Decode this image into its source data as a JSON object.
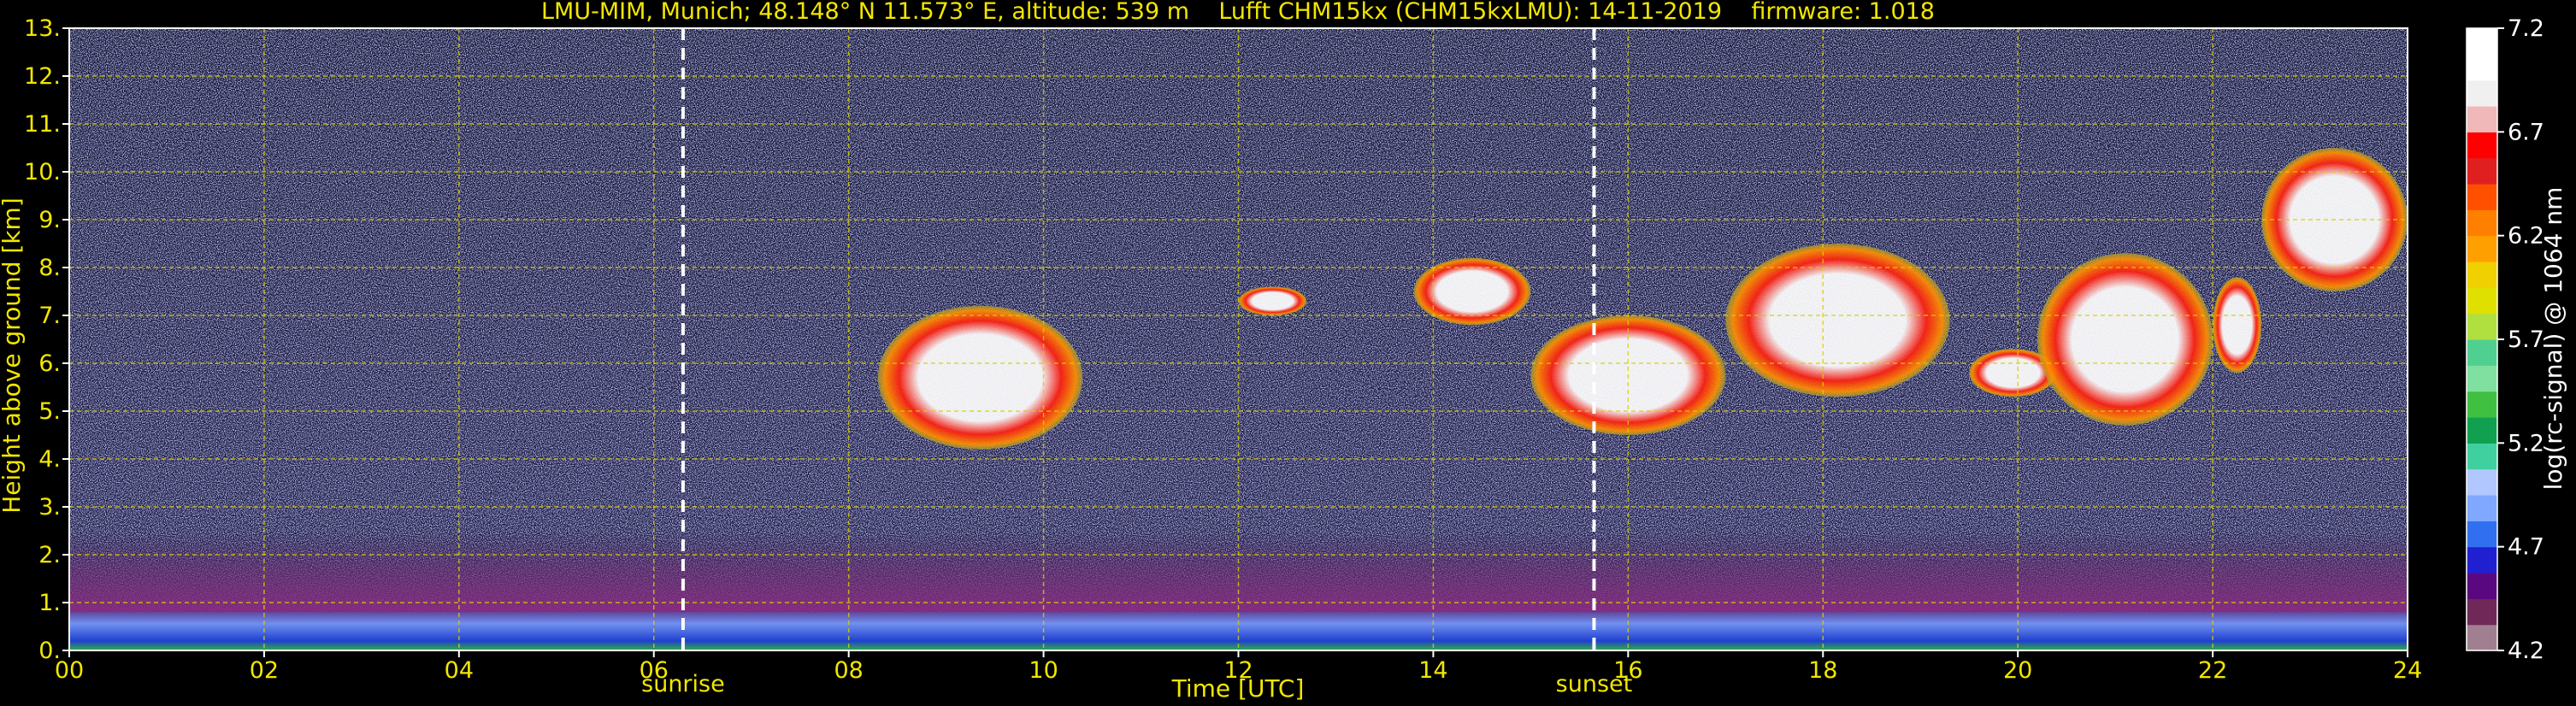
{
  "chart_data": {
    "type": "heatmap",
    "title": "LMU-MIM, Munich; 48.148° N 11.573° E, altitude: 539 m    Lufft CHM15kx (CHM15kxLMU): 14-11-2019    firmware: 1.018",
    "xlabel": "Time [UTC]",
    "ylabel": "Height above ground [km]",
    "xlim": [
      0,
      24
    ],
    "ylim": [
      0,
      13
    ],
    "x_ticks": [
      "00",
      "02",
      "04",
      "06",
      "08",
      "10",
      "12",
      "14",
      "16",
      "18",
      "20",
      "22",
      "24"
    ],
    "y_ticks": [
      "0.",
      "1.",
      "2.",
      "3.",
      "4.",
      "5.",
      "6.",
      "7.",
      "8.",
      "9.",
      "10.",
      "11.",
      "12.",
      "13."
    ],
    "grid": true,
    "events": [
      {
        "label": "sunrise",
        "time": 6.3
      },
      {
        "label": "sunset",
        "time": 15.65
      }
    ],
    "colorbar": {
      "label": "log(rc-signal) @ 1064 nm",
      "range": [
        4.2,
        7.2
      ],
      "ticks": [
        "4.2",
        "4.7",
        "5.2",
        "5.7",
        "6.2",
        "6.7",
        "7.2"
      ],
      "colors": [
        "#a08090",
        "#702858",
        "#5a0880",
        "#2020d0",
        "#3070f0",
        "#80a8ff",
        "#b0c8ff",
        "#40d0a0",
        "#10a050",
        "#40c040",
        "#80e0a0",
        "#50d090",
        "#b0e040",
        "#e0e000",
        "#f0d000",
        "#ffa000",
        "#ff8000",
        "#ff5000",
        "#e02020",
        "#ff0000",
        "#f0b8b8",
        "#f0f0f0",
        "#ffffff",
        "#ffffff"
      ]
    },
    "features": [
      {
        "name": "boundary layer",
        "time_range": [
          0,
          24
        ],
        "height_range": [
          0,
          0.8
        ]
      },
      {
        "name": "aerosol layer",
        "time_range": [
          0,
          24
        ],
        "height_range": [
          0.8,
          2.5
        ]
      },
      {
        "name": "cloud",
        "time_range": [
          8.3,
          10.4
        ],
        "height_range": [
          4.2,
          7.2
        ]
      },
      {
        "name": "cloud",
        "time_range": [
          12.0,
          12.7
        ],
        "height_range": [
          7.0,
          7.6
        ]
      },
      {
        "name": "cloud",
        "time_range": [
          13.8,
          15.0
        ],
        "height_range": [
          6.8,
          8.2
        ]
      },
      {
        "name": "cloud",
        "time_range": [
          15.0,
          17.0
        ],
        "height_range": [
          4.5,
          7.0
        ]
      },
      {
        "name": "cloud",
        "time_range": [
          17.0,
          19.3
        ],
        "height_range": [
          5.3,
          8.5
        ]
      },
      {
        "name": "cloud",
        "time_range": [
          19.5,
          20.4
        ],
        "height_range": [
          5.3,
          6.3
        ]
      },
      {
        "name": "cloud",
        "time_range": [
          20.2,
          22.0
        ],
        "height_range": [
          4.7,
          8.3
        ]
      },
      {
        "name": "cloud",
        "time_range": [
          22.0,
          22.5
        ],
        "height_range": [
          5.8,
          7.8
        ]
      },
      {
        "name": "cloud",
        "time_range": [
          22.5,
          24.0
        ],
        "height_range": [
          7.5,
          10.5
        ]
      }
    ]
  }
}
